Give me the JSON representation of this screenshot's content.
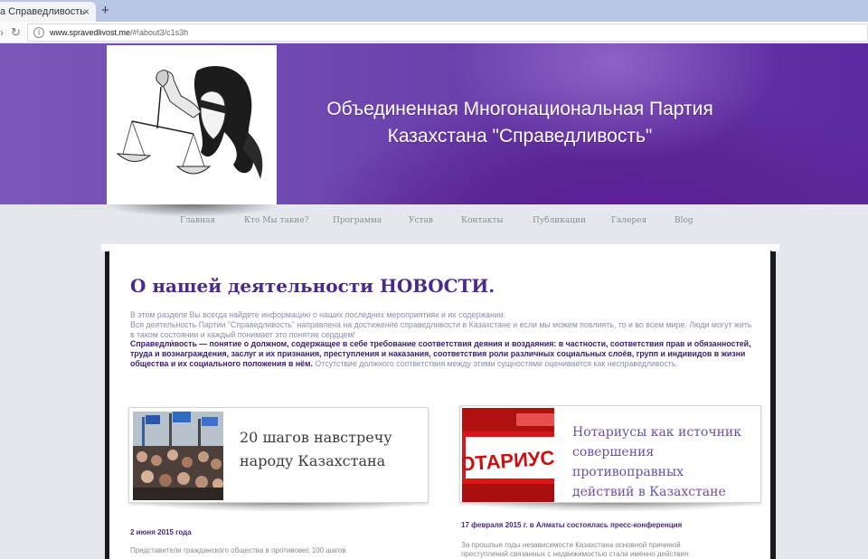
{
  "browser": {
    "tab_title": "а Справедливость",
    "tab_close": "×",
    "new_tab": "+",
    "url_host": "www.spravedlivost.me",
    "url_path": "/#!about3/c1s3h"
  },
  "header": {
    "title_line1": "Объединенная Многонациональная Партия",
    "title_line2": "Казахстана \"Справедливость\""
  },
  "nav": {
    "items": [
      "Главная",
      "Кто Мы такие?",
      "Программа",
      "Устав",
      "Контакты",
      "Публикации",
      "Галерея",
      "Blog"
    ]
  },
  "main": {
    "title": "О нашей деятельности НОВОСТИ.",
    "intro_line1": "В этом разделе Вы всегда найдете информацию о наших последних мероприятиях и их содержании.",
    "intro_line2": "Вся деятельность Партии \"Справедливость\" направлена на достижение справедливости в Казахстане и если мы можем повлиять, то и во всем мире. Люди могут жить в таком состоянии и каждый понимает это понятие сердцем!",
    "intro_bold": "Справедли́вость — понятие о должном, содержащее в себе требование соответствия деяния и воздаяния: в частности, соответствия прав и обязанностей, труда и вознаграждения, заслуг и их признания, преступления и наказания, соответствия роли различных социальных слоёв, групп и индивидов в жизни общества и их социального положения в нём.",
    "intro_tail": " Отсутствие должного соответствия между этими сущностями оценивается как несправедливость."
  },
  "news": [
    {
      "title_line1": "20 шагов навстречу",
      "title_line2": "народу Казахстана",
      "date": "2 июня 2015 года",
      "text": "Представители гражданского общества в противовес 100 шагов"
    },
    {
      "image_text": "ОТАРИУС",
      "title_line1": "Нотариусы как источник",
      "title_line2": "совершения противоправных",
      "title_line3": "действий в Казахстане",
      "date": "17 февраля 2015 г. в Алматы состоялась пресс-конференция",
      "text_line1": "За прошлые годы независимости Казахстана основной причиной",
      "text_line2": "преступлений связанных с недвижимостью стали именно действия"
    }
  ],
  "colors": {
    "header_purple": "#6d44ae",
    "title_purple": "#4a2b8c",
    "nav_gray": "#8a8f99"
  }
}
